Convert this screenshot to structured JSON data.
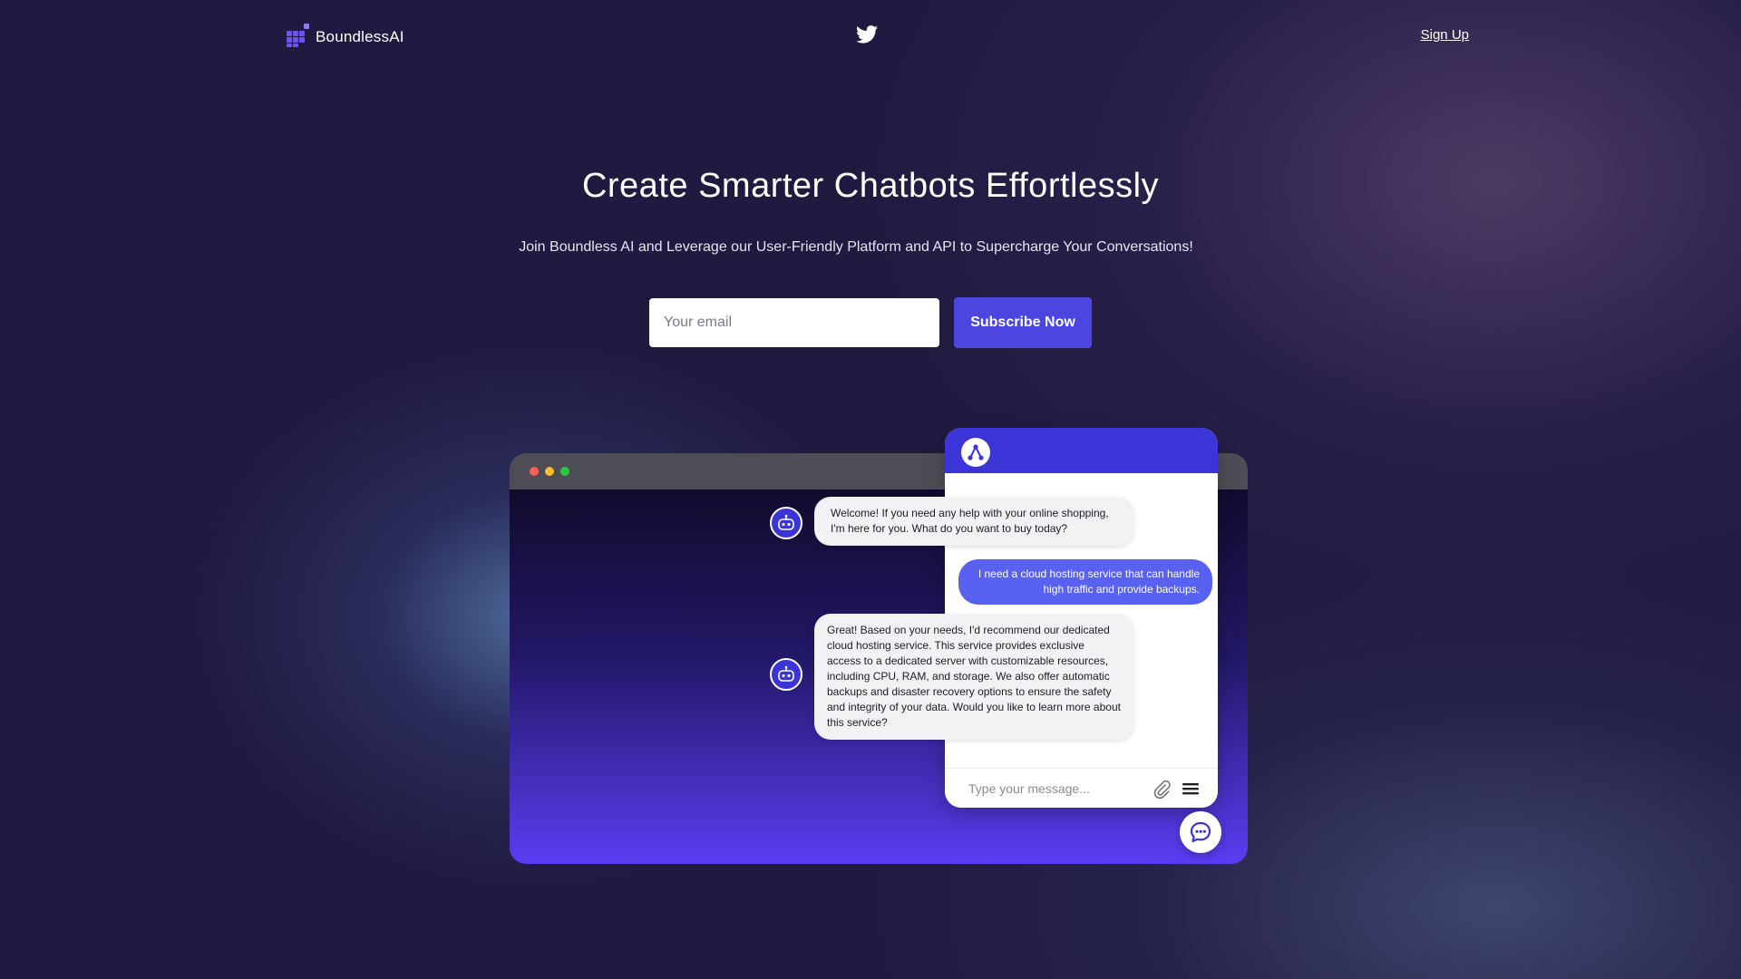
{
  "brand": {
    "name": "BoundlessAI",
    "accent": "#4c45e0"
  },
  "header": {
    "social_icon": "twitter-icon",
    "signup_label": "Sign Up"
  },
  "hero": {
    "title": "Create Smarter Chatbots Effortlessly",
    "subtitle": "Join Boundless AI and Leverage our User-Friendly Platform and API to Supercharge Your Conversations!",
    "email_placeholder": "Your email",
    "subscribe_label": "Subscribe Now"
  },
  "chat": {
    "messages": [
      {
        "sender": "bot",
        "text": "Welcome! If you need any help with your online shopping, I'm here for you. What do you want to buy today?"
      },
      {
        "sender": "user",
        "text": "I need a cloud hosting service that can handle high traffic and provide backups."
      },
      {
        "sender": "bot",
        "text": "Great! Based on your needs, I'd recommend our dedicated cloud hosting service. This service provides exclusive access to a dedicated server with customizable resources, including CPU, RAM, and storage. We also offer automatic backups and disaster recovery options to ensure the safety and integrity of your data. Would you like to learn more about this service?"
      }
    ],
    "input_placeholder": "Type your message..."
  },
  "colors": {
    "widget_header": "#3b34d6",
    "user_bubble": "#5961f0",
    "window_dots": [
      "#ff5f57",
      "#febc2e",
      "#28c840"
    ]
  }
}
